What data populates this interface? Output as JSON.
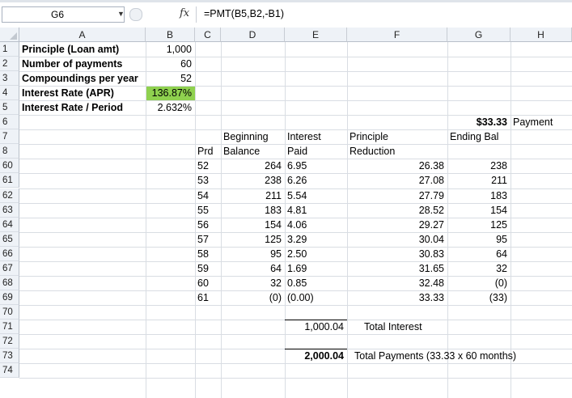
{
  "formula_bar": {
    "name_box": "G6",
    "fx": "fx",
    "formula": "=PMT(B5,B2,-B1)"
  },
  "columns": [
    "A",
    "B",
    "C",
    "D",
    "E",
    "F",
    "G",
    "H"
  ],
  "rows": [
    "1",
    "2",
    "3",
    "4",
    "5",
    "6",
    "7",
    "8",
    "60",
    "61",
    "62",
    "63",
    "64",
    "65",
    "66",
    "67",
    "68",
    "69",
    "70",
    "71",
    "72",
    "73",
    "74"
  ],
  "inputs": [
    {
      "label": "Principle (Loan amt)",
      "value": "1,000"
    },
    {
      "label": "Number of payments",
      "value": "60"
    },
    {
      "label": "Compoundings per year",
      "value": "52"
    },
    {
      "label": "Interest Rate (APR)",
      "value": "136.87%"
    },
    {
      "label": "Interest Rate / Period",
      "value": "2.632%"
    }
  ],
  "payment": {
    "value": "$33.33",
    "label": "Payment"
  },
  "headers": {
    "d7": "Beginning",
    "e7": "Interest",
    "f7": "Principle",
    "g7": "Ending Bal",
    "c8": "Prd",
    "d8": "Balance",
    "e8": "Paid",
    "f8": "Reduction"
  },
  "table": [
    {
      "prd": "52",
      "beg": "264",
      "int": "6.95",
      "prin": "26.38",
      "end": "238"
    },
    {
      "prd": "53",
      "beg": "238",
      "int": "6.26",
      "prin": "27.08",
      "end": "211"
    },
    {
      "prd": "54",
      "beg": "211",
      "int": "5.54",
      "prin": "27.79",
      "end": "183"
    },
    {
      "prd": "55",
      "beg": "183",
      "int": "4.81",
      "prin": "28.52",
      "end": "154"
    },
    {
      "prd": "56",
      "beg": "154",
      "int": "4.06",
      "prin": "29.27",
      "end": "125"
    },
    {
      "prd": "57",
      "beg": "125",
      "int": "3.29",
      "prin": "30.04",
      "end": "95"
    },
    {
      "prd": "58",
      "beg": "95",
      "int": "2.50",
      "prin": "30.83",
      "end": "64"
    },
    {
      "prd": "59",
      "beg": "64",
      "int": "1.69",
      "prin": "31.65",
      "end": "32"
    },
    {
      "prd": "60",
      "beg": "32",
      "int": "0.85",
      "prin": "32.48",
      "end": "(0)"
    },
    {
      "prd": "61",
      "beg": "(0)",
      "int": "(0.00)",
      "prin": "33.33",
      "end": "(33)"
    }
  ],
  "totals": {
    "interest_value": "1,000.04",
    "interest_label": "Total Interest",
    "payments_value": "2,000.04",
    "payments_label": "Total Payments (33.33 x 60 months)"
  },
  "colors": {
    "highlight": "#8fd14f"
  }
}
